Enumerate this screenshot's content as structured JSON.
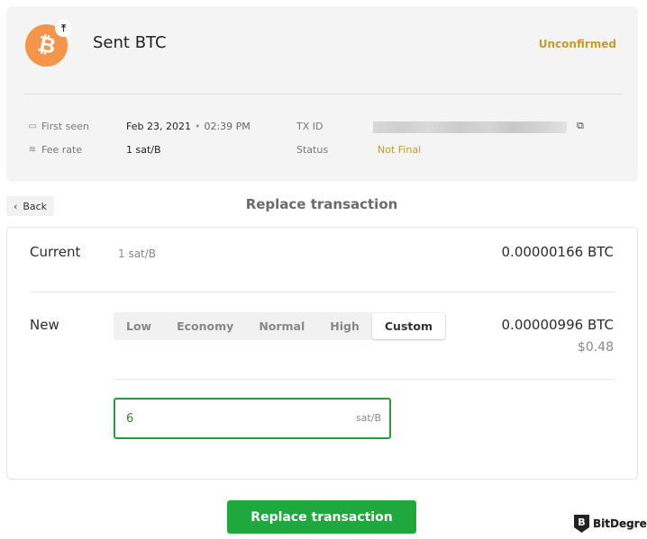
{
  "transaction": {
    "icon": "bitcoin-icon",
    "icon_badge": "upload-arrow-icon",
    "title": "Sent BTC",
    "state": "Unconfirmed",
    "details": {
      "first_seen_label": "First seen",
      "first_seen_date": "Feb 23, 2021",
      "first_seen_time": "02:39 PM",
      "fee_rate_label": "Fee rate",
      "fee_rate_value": "1 sat/B",
      "txid_label": "TX ID",
      "txid_value": "",
      "status_label": "Status",
      "status_value": "Not Final"
    }
  },
  "nav": {
    "back_label": "Back",
    "page_title": "Replace transaction"
  },
  "replace": {
    "current_label": "Current",
    "current_rate": "1 sat/B",
    "current_amount": "0.00000166 BTC",
    "new_label": "New",
    "fee_options": [
      "Low",
      "Economy",
      "Normal",
      "High",
      "Custom"
    ],
    "selected_option": "Custom",
    "new_amount": "0.00000996 BTC",
    "new_fiat": "$0.48",
    "custom_fee_value": "6",
    "custom_fee_unit": "sat/B"
  },
  "actions": {
    "submit_label": "Replace transaction"
  },
  "watermark": {
    "logo_letter": "B",
    "text": "BitDegree"
  },
  "colors": {
    "accent_green": "#1fa83d",
    "warning_gold": "#c69a2e",
    "bitcoin_orange": "#f3954a"
  }
}
